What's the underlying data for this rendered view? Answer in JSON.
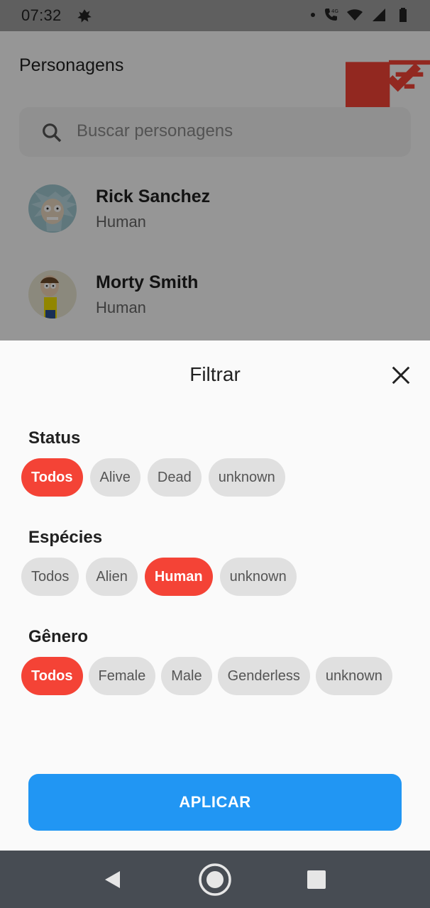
{
  "status_bar": {
    "time": "07:32",
    "network": "4G"
  },
  "app_bar": {
    "title": "Personagens"
  },
  "search": {
    "placeholder": "Buscar personagens"
  },
  "characters": [
    {
      "name": "Rick Sanchez",
      "species": "Human"
    },
    {
      "name": "Morty Smith",
      "species": "Human"
    }
  ],
  "filter_sheet": {
    "title": "Filtrar",
    "sections": [
      {
        "label": "Status",
        "options": [
          "Todos",
          "Alive",
          "Dead",
          "unknown"
        ],
        "selected": "Todos"
      },
      {
        "label": "Espécies",
        "options": [
          "Todos",
          "Alien",
          "Human",
          "unknown"
        ],
        "selected": "Human"
      },
      {
        "label": "Gênero",
        "options": [
          "Todos",
          "Female",
          "Male",
          "Genderless",
          "unknown"
        ],
        "selected": "Todos"
      }
    ],
    "apply_label": "APLICAR"
  },
  "colors": {
    "accent": "#f44336",
    "primary_button": "#2196f3",
    "chip_bg": "#e0e0e0",
    "nav_bar": "#474c53"
  },
  "icons": [
    "app-notification-icon",
    "call-icon",
    "wifi-icon",
    "signal-icon",
    "battery-icon",
    "bookmark-check-icon",
    "filter-icon",
    "search-icon",
    "close-icon",
    "back-icon",
    "home-icon",
    "recents-icon"
  ]
}
